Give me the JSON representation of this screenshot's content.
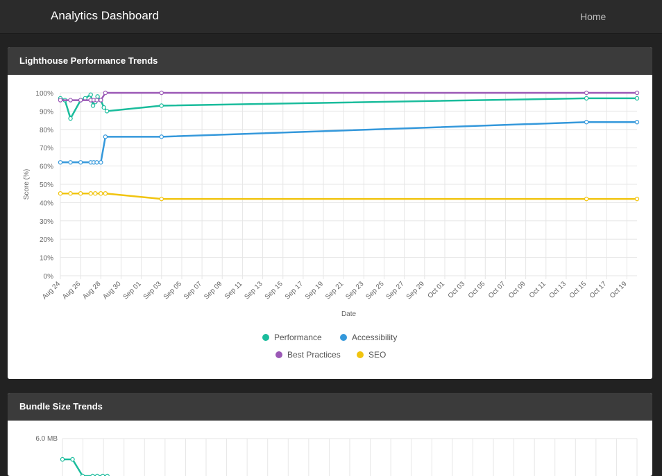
{
  "navbar": {
    "brand": "Analytics Dashboard",
    "home_label": "Home"
  },
  "cards": [
    {
      "title": "Lighthouse Performance Trends"
    },
    {
      "title": "Bundle Size Trends"
    }
  ],
  "chart_data": [
    {
      "type": "line",
      "title": "Lighthouse Performance Trends",
      "xlabel": "Date",
      "ylabel": "Score (%)",
      "x_ticks": [
        "Aug 24",
        "Aug 26",
        "Aug 28",
        "Aug 30",
        "Sep 01",
        "Sep 03",
        "Sep 05",
        "Sep 07",
        "Sep 09",
        "Sep 11",
        "Sep 13",
        "Sep 15",
        "Sep 17",
        "Sep 19",
        "Sep 21",
        "Sep 23",
        "Sep 25",
        "Sep 27",
        "Sep 29",
        "Oct 01",
        "Oct 03",
        "Oct 05",
        "Oct 07",
        "Oct 09",
        "Oct 11",
        "Oct 13",
        "Oct 15",
        "Oct 17",
        "Oct 19"
      ],
      "y_ticks": [
        "0%",
        "10%",
        "20%",
        "30%",
        "40%",
        "50%",
        "60%",
        "70%",
        "80%",
        "90%",
        "100%"
      ],
      "ylim": [
        0,
        100
      ],
      "grid": true,
      "legend_position": "bottom",
      "series": [
        {
          "name": "Performance",
          "color": "#1abc9c",
          "points": [
            {
              "x": "Aug 24",
              "y": 97
            },
            {
              "x": "Aug 24",
              "y": 96
            },
            {
              "x": "Aug 25",
              "y": 86
            },
            {
              "x": "Aug 26",
              "y": 96
            },
            {
              "x": "Aug 26",
              "y": 97
            },
            {
              "x": "Aug 27",
              "y": 99
            },
            {
              "x": "Aug 27",
              "y": 93
            },
            {
              "x": "Aug 27",
              "y": 95
            },
            {
              "x": "Aug 27",
              "y": 98
            },
            {
              "x": "Aug 28",
              "y": 96
            },
            {
              "x": "Aug 28",
              "y": 92
            },
            {
              "x": "Aug 28",
              "y": 90
            },
            {
              "x": "Sep 03",
              "y": 93
            },
            {
              "x": "Oct 15",
              "y": 97
            },
            {
              "x": "Oct 20",
              "y": 97
            }
          ]
        },
        {
          "name": "Accessibility",
          "color": "#3498db",
          "points": [
            {
              "x": "Aug 24",
              "y": 62
            },
            {
              "x": "Aug 25",
              "y": 62
            },
            {
              "x": "Aug 26",
              "y": 62
            },
            {
              "x": "Aug 27",
              "y": 62
            },
            {
              "x": "Aug 27",
              "y": 62
            },
            {
              "x": "Aug 27",
              "y": 62
            },
            {
              "x": "Aug 28",
              "y": 62
            },
            {
              "x": "Aug 28",
              "y": 76
            },
            {
              "x": "Sep 03",
              "y": 76
            },
            {
              "x": "Oct 15",
              "y": 84
            },
            {
              "x": "Oct 20",
              "y": 84
            }
          ]
        },
        {
          "name": "Best Practices",
          "color": "#9b59b6",
          "points": [
            {
              "x": "Aug 24",
              "y": 96
            },
            {
              "x": "Aug 25",
              "y": 96
            },
            {
              "x": "Aug 26",
              "y": 96
            },
            {
              "x": "Aug 27",
              "y": 96
            },
            {
              "x": "Aug 27",
              "y": 96
            },
            {
              "x": "Aug 27",
              "y": 96
            },
            {
              "x": "Aug 28",
              "y": 96
            },
            {
              "x": "Aug 28",
              "y": 100
            },
            {
              "x": "Sep 03",
              "y": 100
            },
            {
              "x": "Oct 15",
              "y": 100
            },
            {
              "x": "Oct 20",
              "y": 100
            }
          ]
        },
        {
          "name": "SEO",
          "color": "#f1c40f",
          "points": [
            {
              "x": "Aug 24",
              "y": 45
            },
            {
              "x": "Aug 25",
              "y": 45
            },
            {
              "x": "Aug 26",
              "y": 45
            },
            {
              "x": "Aug 27",
              "y": 45
            },
            {
              "x": "Aug 27",
              "y": 45
            },
            {
              "x": "Aug 28",
              "y": 45
            },
            {
              "x": "Aug 28",
              "y": 45
            },
            {
              "x": "Sep 03",
              "y": 42
            },
            {
              "x": "Oct 15",
              "y": 42
            },
            {
              "x": "Oct 20",
              "y": 42
            }
          ]
        }
      ]
    },
    {
      "type": "line",
      "title": "Bundle Size Trends",
      "y_ticks": [
        "6.0 MB"
      ],
      "series": [
        {
          "color": "#1abc9c",
          "points": [
            {
              "x": "Aug 24",
              "y": 5.5
            },
            {
              "x": "Aug 25",
              "y": 5.5
            },
            {
              "x": "Aug 26",
              "y": 5.1
            },
            {
              "x": "Aug 27",
              "y": 5.1
            },
            {
              "x": "Aug 27",
              "y": 5.1
            },
            {
              "x": "Aug 28",
              "y": 5.1
            },
            {
              "x": "Aug 28",
              "y": 5.1
            }
          ]
        }
      ]
    }
  ]
}
